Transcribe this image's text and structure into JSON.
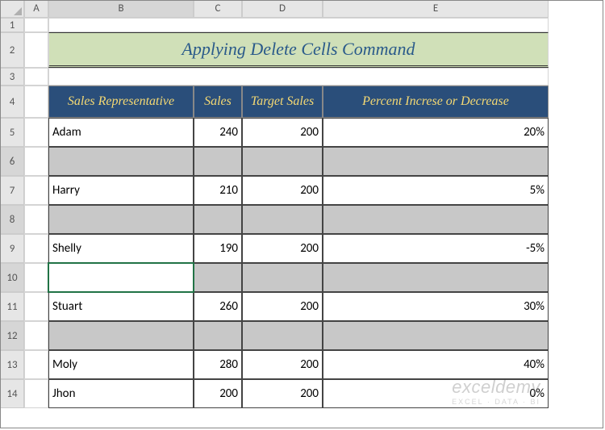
{
  "columns": [
    "",
    "A",
    "B",
    "C",
    "D",
    "E"
  ],
  "title": "Applying Delete Cells Command",
  "headers": {
    "rep": "Sales Representative",
    "sales": "Sales",
    "target": "Target Sales",
    "pct": "Percent Increse or Decrease"
  },
  "rows": [
    {
      "num": 5,
      "rep": "Adam",
      "sales": "240",
      "target": "200",
      "pct": "20%",
      "blank": false
    },
    {
      "num": 6,
      "rep": "",
      "sales": "",
      "target": "",
      "pct": "",
      "blank": true
    },
    {
      "num": 7,
      "rep": "Harry",
      "sales": "210",
      "target": "200",
      "pct": "5%",
      "blank": false
    },
    {
      "num": 8,
      "rep": "",
      "sales": "",
      "target": "",
      "pct": "",
      "blank": true
    },
    {
      "num": 9,
      "rep": "Shelly",
      "sales": "190",
      "target": "200",
      "pct": "-5%",
      "blank": false
    },
    {
      "num": 10,
      "rep": "",
      "sales": "",
      "target": "",
      "pct": "",
      "blank": true
    },
    {
      "num": 11,
      "rep": "Stuart",
      "sales": "260",
      "target": "200",
      "pct": "30%",
      "blank": false
    },
    {
      "num": 12,
      "rep": "",
      "sales": "",
      "target": "",
      "pct": "",
      "blank": true
    },
    {
      "num": 13,
      "rep": "Moly",
      "sales": "280",
      "target": "200",
      "pct": "40%",
      "blank": false
    },
    {
      "num": 14,
      "rep": "Jhon",
      "sales": "200",
      "target": "200",
      "pct": "0%",
      "blank": false
    }
  ],
  "active_cell": "B10",
  "selected_rows": [
    6,
    8,
    10,
    12
  ],
  "watermark": {
    "main": "exceldemy",
    "sub": "EXCEL · DATA · BI"
  },
  "chart_data": {
    "type": "table",
    "title": "Applying Delete Cells Command",
    "columns": [
      "Sales Representative",
      "Sales",
      "Target Sales",
      "Percent Increse or Decrease"
    ],
    "records": [
      {
        "Sales Representative": "Adam",
        "Sales": 240,
        "Target Sales": 200,
        "Percent Increse or Decrease": "20%"
      },
      {
        "Sales Representative": "Harry",
        "Sales": 210,
        "Target Sales": 200,
        "Percent Increse or Decrease": "5%"
      },
      {
        "Sales Representative": "Shelly",
        "Sales": 190,
        "Target Sales": 200,
        "Percent Increse or Decrease": "-5%"
      },
      {
        "Sales Representative": "Stuart",
        "Sales": 260,
        "Target Sales": 200,
        "Percent Increse or Decrease": "30%"
      },
      {
        "Sales Representative": "Moly",
        "Sales": 280,
        "Target Sales": 200,
        "Percent Increse or Decrease": "40%"
      },
      {
        "Sales Representative": "Jhon",
        "Sales": 200,
        "Target Sales": 200,
        "Percent Increse or Decrease": "0%"
      }
    ]
  }
}
